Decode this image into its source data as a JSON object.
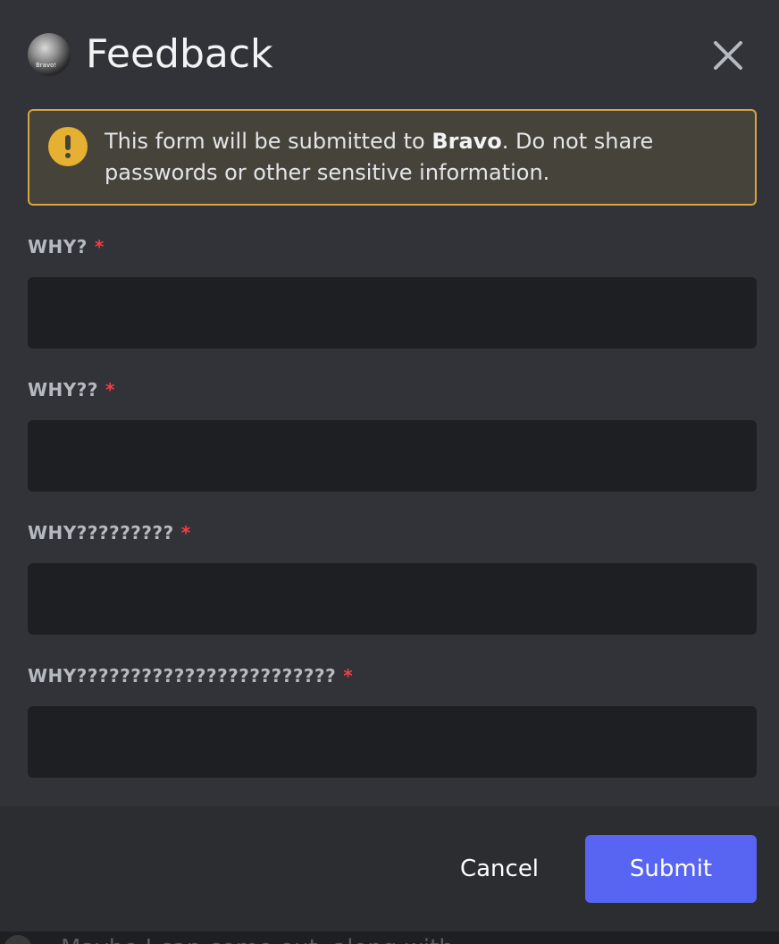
{
  "modal": {
    "title": "Feedback",
    "avatar_text": "Bravo!",
    "notice": {
      "prefix": "This form will be submitted to ",
      "app_name": "Bravo",
      "suffix": ". Do not share passwords or other sensitive information."
    },
    "fields": [
      {
        "label": "WHY?",
        "required_mark": "*",
        "value": ""
      },
      {
        "label": "WHY??",
        "required_mark": "*",
        "value": ""
      },
      {
        "label": "WHY?????????",
        "required_mark": "*",
        "value": ""
      },
      {
        "label": "WHY????????????????????????",
        "required_mark": "*",
        "value": ""
      }
    ],
    "footer": {
      "cancel_label": "Cancel",
      "submit_label": "Submit"
    }
  },
  "background": {
    "partial_text": "Maybe I can come out, along with"
  },
  "colors": {
    "modal_bg": "#313338",
    "footer_bg": "#2b2d31",
    "input_bg": "#1e1f22",
    "warning_border": "#d7a541",
    "warning_icon": "#e6b032",
    "required": "#f23f43",
    "primary_button": "#5865f2"
  },
  "icons": {
    "close": "close-icon",
    "warning": "warning-icon"
  }
}
